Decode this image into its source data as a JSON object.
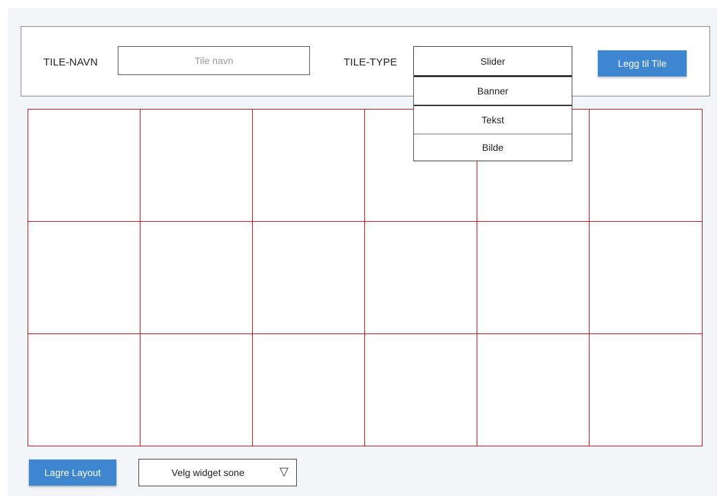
{
  "header": {
    "tile_name_label": "TILE-NAVN",
    "tile_name_input": {
      "value": "",
      "placeholder": "Tile navn"
    },
    "tile_type_label": "TILE-TYPE",
    "tile_type_selected": "Slider",
    "tile_type_options": [
      "Banner",
      "Tekst",
      "Bilde"
    ],
    "add_tile_button": "Legg til Tile"
  },
  "grid": {
    "columns": 6,
    "rows": 3,
    "cell_border_color": "#d3121c"
  },
  "footer": {
    "save_layout_button": "Lagre Layout",
    "widget_zone_select": "Velg widget sone",
    "widget_zone_icon": "triangle-down-icon"
  },
  "colors": {
    "primary_button": "#3f86d0",
    "background": "#f2f6f9"
  }
}
